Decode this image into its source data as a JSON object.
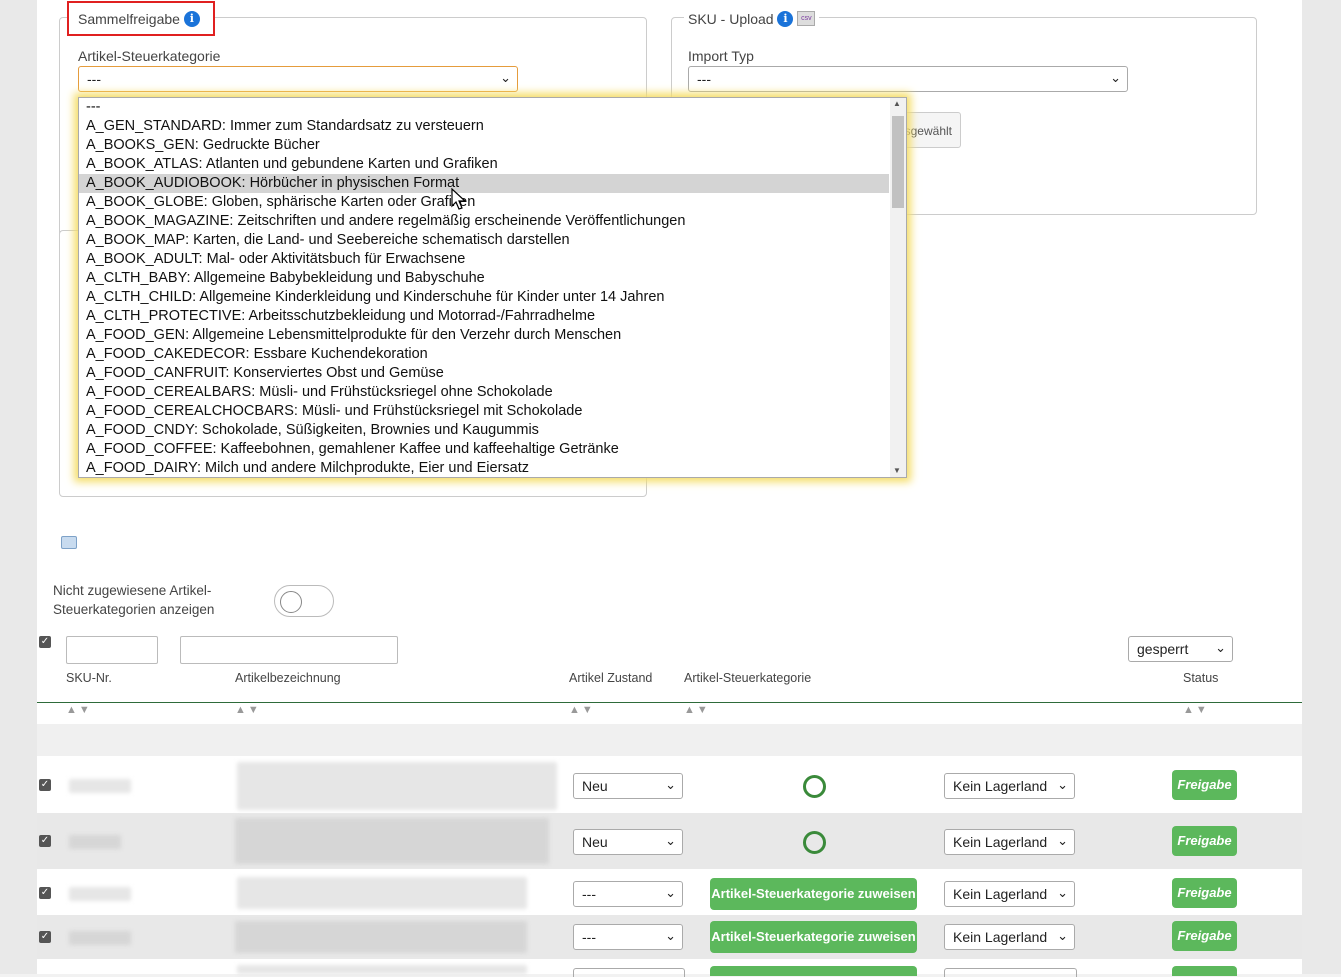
{
  "sammelfreigabe": {
    "legend": "Sammelfreigabe",
    "info_glyph": "i",
    "field_label": "Artikel-Steuerkategorie",
    "selected": "---",
    "highlight_color": "#e02020"
  },
  "sku_upload": {
    "legend": "SKU - Upload",
    "info_glyph": "i",
    "csv_glyph": "csv",
    "field_label": "Import Typ",
    "selected": "---",
    "button_partial": "sgewählt"
  },
  "dropdown": {
    "options": [
      "---",
      "A_GEN_STANDARD: Immer zum Standardsatz zu versteuern",
      "A_BOOKS_GEN: Gedruckte Bücher",
      "A_BOOK_ATLAS: Atlanten und gebundene Karten und Grafiken",
      "A_BOOK_AUDIOBOOK: Hörbücher in physischen Format",
      "A_BOOK_GLOBE: Globen, sphärische Karten oder Grafiken",
      "A_BOOK_MAGAZINE: Zeitschriften und andere regelmäßig erscheinende Veröffentlichungen",
      "A_BOOK_MAP: Karten, die Land- und Seebereiche schematisch darstellen",
      "A_BOOK_ADULT: Mal- oder Aktivitätsbuch für Erwachsene",
      "A_CLTH_BABY: Allgemeine Babybekleidung und Babyschuhe",
      "A_CLTH_CHILD: Allgemeine Kinderkleidung und Kinderschuhe für Kinder unter 14 Jahren",
      "A_CLTH_PROTECTIVE: Arbeitsschutzbekleidung und Motorrad-/Fahrradhelme",
      "A_FOOD_GEN: Allgemeine Lebensmittelprodukte für den Verzehr durch Menschen",
      "A_FOOD_CAKEDECOR: Essbare Kuchendekoration",
      "A_FOOD_CANFRUIT: Konserviertes Obst und Gemüse",
      "A_FOOD_CEREALBARS: Müsli- und Frühstücksriegel ohne Schokolade",
      "A_FOOD_CEREALCHOCBARS: Müsli- und Frühstücksriegel mit Schokolade",
      "A_FOOD_CNDY: Schokolade, Süßigkeiten, Brownies und Kaugummis",
      "A_FOOD_COFFEE: Kaffeebohnen, gemahlener Kaffee und kaffeehaltige Getränke",
      "A_FOOD_DAIRY: Milch und andere Milchprodukte, Eier und Eiersatz"
    ],
    "hovered_index": 4,
    "scroll_up": "▲",
    "scroll_down": "▼"
  },
  "filter": {
    "toggle_label_line1": "Nicht zugewiesene Artikel-",
    "toggle_label_line2": "Steuerkategorien anzeigen",
    "status_select": "gesperrt"
  },
  "table": {
    "headers": {
      "sku": "SKU-Nr.",
      "bezeichnung": "Artikelbezeichnung",
      "zustand": "Artikel Zustand",
      "steuerkategorie": "Artikel-Steuerkategorie",
      "status": "Status"
    },
    "sort_glyph": "▲▼",
    "rows": [
      {
        "zustand": "Neu",
        "lagerland": "Kein Lagerland",
        "action": "Freigabe"
      },
      {
        "zustand": "Neu",
        "lagerland": "Kein Lagerland",
        "action": "Freigabe"
      },
      {
        "zustand": "---",
        "assign": "Artikel-Steuerkategorie zuweisen",
        "lagerland": "Kein Lagerland",
        "action": "Freigabe"
      },
      {
        "zustand": "---",
        "assign": "Artikel-Steuerkategorie zuweisen",
        "lagerland": "Kein Lagerland",
        "action": "Freigabe"
      }
    ],
    "check_glyph": "✓",
    "chevron": "⌄"
  },
  "colors": {
    "accent_green": "#5cb85c",
    "info_blue": "#1a73d9",
    "focus_orange": "#e59c3c"
  }
}
